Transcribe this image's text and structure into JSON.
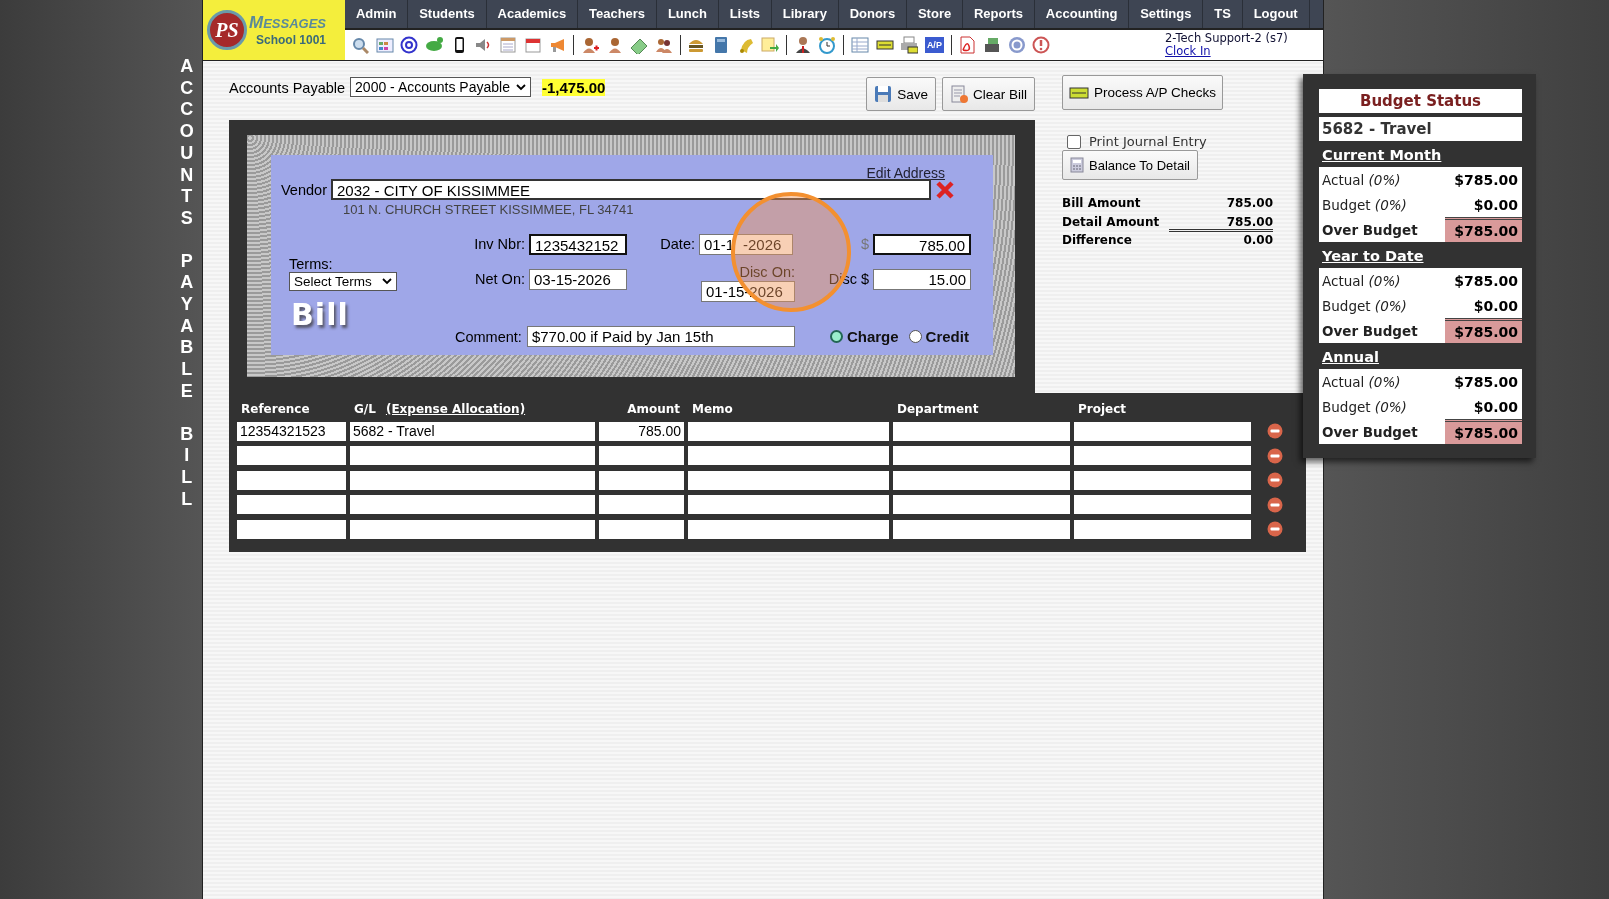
{
  "logo": {
    "monogram": "PS",
    "title": "MESSAGES",
    "subtitle": "School 1001"
  },
  "nav": [
    "Admin",
    "Students",
    "Academics",
    "Teachers",
    "Lunch",
    "Lists",
    "Library",
    "Donors",
    "Store",
    "Reports",
    "Accounting",
    "Settings",
    "TS",
    "Logout"
  ],
  "toolbar": {
    "ap_icon_label": "A/P"
  },
  "user": {
    "name": "2-Tech Support-2 (s7)",
    "link": "Clock In"
  },
  "side_title": "ACCOUNTS PAYABLE BILL",
  "account": {
    "label": "Accounts Payable",
    "selected": "2000 - Accounts Payable",
    "balance": "-1,475.00"
  },
  "buttons": [
    {
      "kind": "save",
      "label": "Save"
    },
    {
      "kind": "clear",
      "label": "Clear Bill"
    }
  ],
  "process_button": "Process A/P Checks",
  "bill": {
    "edit_link": "Edit Address",
    "vendor_label": "Vendor",
    "vendor": "2032 - CITY OF KISSIMMEE",
    "address": "101 N. CHURCH STREET KISSIMMEE, FL 34741",
    "terms_label": "Terms:",
    "terms": "Select Terms",
    "stamp": "Bill",
    "inv_label": "Inv Nbr:",
    "inv": "1235432152",
    "net_label": "Net On:",
    "net": "03-15-2026",
    "date_label": "Date:",
    "date_start": "01-1",
    "date_end": "-2026",
    "disc_on_label": "Disc On:",
    "disc_on": "01-15-2026",
    "amount_label": "$",
    "amount": "785.00",
    "disc_label": "Disc $",
    "disc": "15.00",
    "comment_label": "Comment:",
    "comment": "$770.00 if Paid by Jan 15th",
    "types": [
      {
        "label": "Charge",
        "selected": true
      },
      {
        "label": "Credit",
        "selected": false
      }
    ]
  },
  "print_journal": {
    "label": "Print Journal Entry",
    "checked": false
  },
  "balance_button": "Balance To Detail",
  "totals": [
    {
      "label": "Bill Amount",
      "value": "785.00"
    },
    {
      "label": "Detail Amount",
      "value": "785.00"
    },
    {
      "label": "Difference",
      "value": "0.00"
    }
  ],
  "detail": {
    "columns": [
      "Reference",
      "G/L",
      "Amount",
      "Memo",
      "Department",
      "Project"
    ],
    "gl_link": "(Expense Allocation)",
    "rows": [
      {
        "reference": "12354321523",
        "gl": "5682 - Travel",
        "amount": "785.00"
      },
      {},
      {},
      {},
      {}
    ]
  },
  "budget": {
    "title": "Budget Status",
    "account": "5682 - Travel",
    "sections": [
      {
        "title": "Current Month",
        "rows": [
          {
            "kind": "line",
            "label": "Actual",
            "pct": "(0%)",
            "value": "$785.00"
          },
          {
            "kind": "line",
            "label": "Budget",
            "pct": "(0%)",
            "value": "$0.00"
          },
          {
            "kind": "total",
            "label": "Over Budget",
            "value": "$785.00"
          }
        ]
      },
      {
        "title": "Year to Date",
        "rows": [
          {
            "kind": "line",
            "label": "Actual",
            "pct": "(0%)",
            "value": "$785.00"
          },
          {
            "kind": "line",
            "label": "Budget",
            "pct": "(0%)",
            "value": "$0.00"
          },
          {
            "kind": "total",
            "label": "Over Budget",
            "value": "$785.00"
          }
        ]
      },
      {
        "title": "Annual",
        "rows": [
          {
            "kind": "line",
            "label": "Actual",
            "pct": "(0%)",
            "value": "$785.00"
          },
          {
            "kind": "line",
            "label": "Budget",
            "pct": "(0%)",
            "value": "$0.00"
          },
          {
            "kind": "total",
            "label": "Over Budget",
            "value": "$785.00"
          }
        ]
      }
    ]
  }
}
